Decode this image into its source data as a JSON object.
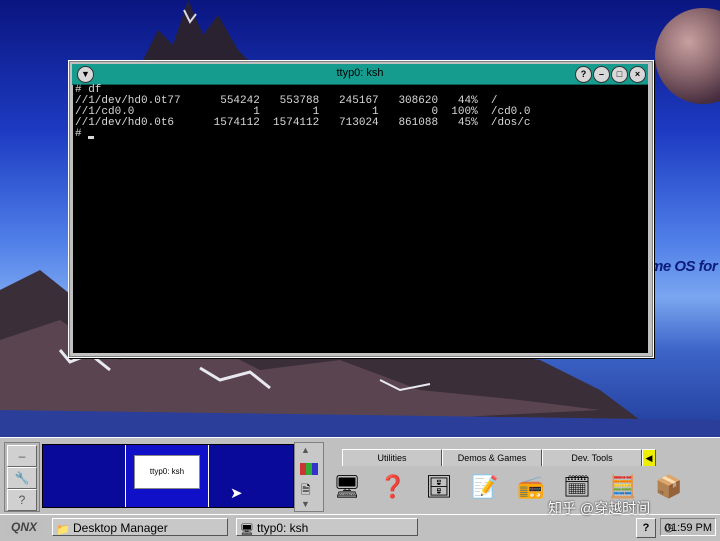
{
  "desktop": {
    "wallpaper_text": "me OS for r"
  },
  "terminal": {
    "title": "ttyp0: ksh",
    "lines": [
      "# df",
      "//1/dev/hd0.0t77      554242   553788   245167   308620   44%  /",
      "//1/cd0.0                  1        1        1        0  100%  /cd0.0",
      "//1/dev/hd0.0t6      1574112  1574112   713024   861088   45%  /dos/c",
      "# "
    ],
    "buttons": {
      "menu": "▼",
      "help": "?",
      "minimize": "–",
      "maximize": "□",
      "close": "×"
    }
  },
  "shelf": {
    "pager_thumbnail_label": "ttyp0: ksh",
    "tabs": [
      "Utilities",
      "Demos & Games",
      "Dev. Tools"
    ],
    "left_buttons": [
      "–",
      "🔧",
      "?"
    ],
    "apps": [
      {
        "icon": "monitor-icon",
        "glyph": "🖥"
      },
      {
        "icon": "help-book-icon",
        "glyph": "❓"
      },
      {
        "icon": "file-cabinet-icon",
        "glyph": "🗄"
      },
      {
        "icon": "notes-icon",
        "glyph": "📝"
      },
      {
        "icon": "boombox-icon",
        "glyph": "📻"
      },
      {
        "icon": "calendar-icon",
        "glyph": "🗓"
      },
      {
        "icon": "calculator-icon",
        "glyph": "🧮"
      },
      {
        "icon": "package-icon",
        "glyph": "📦"
      }
    ]
  },
  "taskbar": {
    "logo": "QNX",
    "tasks": [
      {
        "label": "Desktop Manager"
      },
      {
        "label": "ttyp0: ksh"
      }
    ],
    "help": "?",
    "clock": "01:59 PM"
  },
  "overlay": {
    "watermark": "知乎 @穿越时间"
  }
}
